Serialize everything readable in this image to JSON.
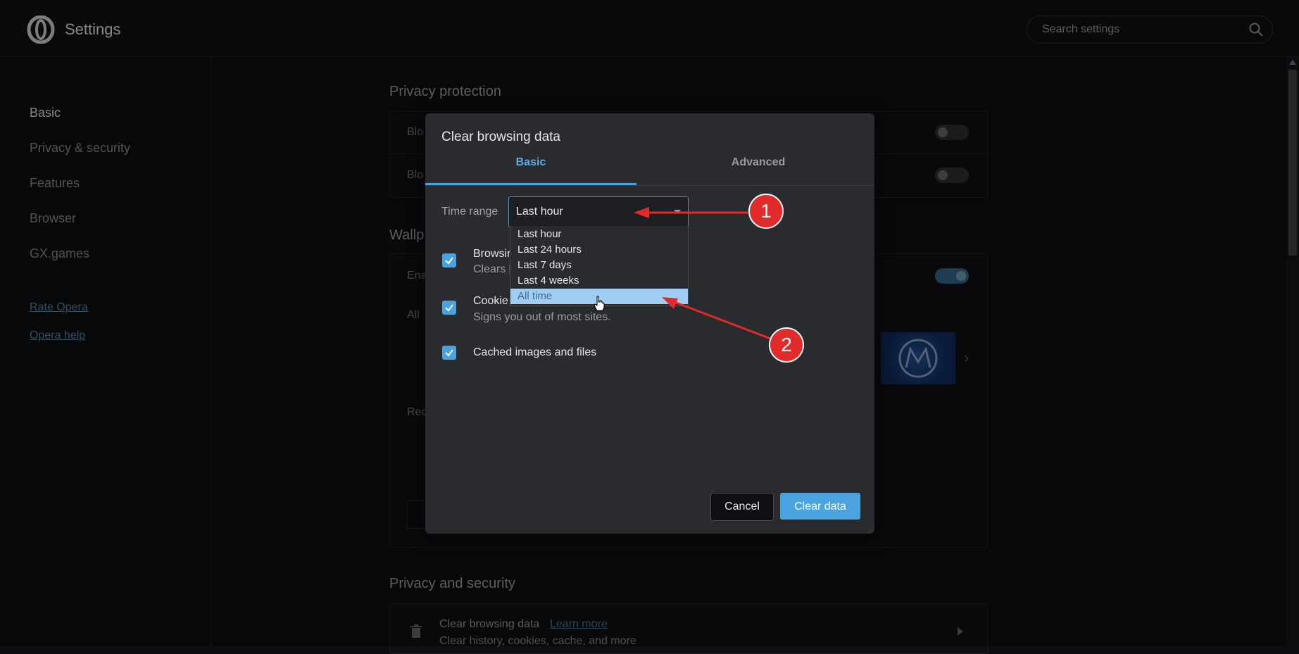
{
  "app": {
    "title": "Settings"
  },
  "search": {
    "placeholder": "Search settings"
  },
  "sidebar": {
    "items": [
      {
        "label": "Basic"
      },
      {
        "label": "Privacy & security"
      },
      {
        "label": "Features"
      },
      {
        "label": "Browser"
      },
      {
        "label": "GX.games"
      }
    ],
    "links": [
      {
        "label": "Rate Opera"
      },
      {
        "label": "Opera help"
      }
    ]
  },
  "background": {
    "privacy_protection_title": "Privacy protection",
    "row1_label": "Blo",
    "row2_label": "Blo",
    "wallpapers_title": "Wallp",
    "enable_label": "Ena",
    "all_label": "All",
    "rec_label": "Rec",
    "privacy_security_title": "Privacy and security",
    "clear_browsing_title": "Clear browsing data",
    "learn_more": "Learn more",
    "clear_browsing_sub": "Clear history, cookies, cache, and more"
  },
  "dialog": {
    "title": "Clear browsing data",
    "tabs": [
      "Basic",
      "Advanced"
    ],
    "time_range_label": "Time range",
    "time_range_value": "Last hour",
    "options": [
      "Last hour",
      "Last 24 hours",
      "Last 7 days",
      "Last 4 weeks",
      "All time"
    ],
    "checkboxes": [
      {
        "title": "Browsir",
        "sub": "Clears l"
      },
      {
        "title": "Cookie",
        "sub": "Signs you out of most sites."
      },
      {
        "title": "Cached images and files"
      }
    ],
    "cancel_label": "Cancel",
    "clear_label": "Clear data"
  },
  "annotations": [
    "1",
    "2"
  ],
  "colors": {
    "accent": "#4aa3df",
    "annotation": "#e12a2a",
    "highlight": "#9fcdf4"
  }
}
